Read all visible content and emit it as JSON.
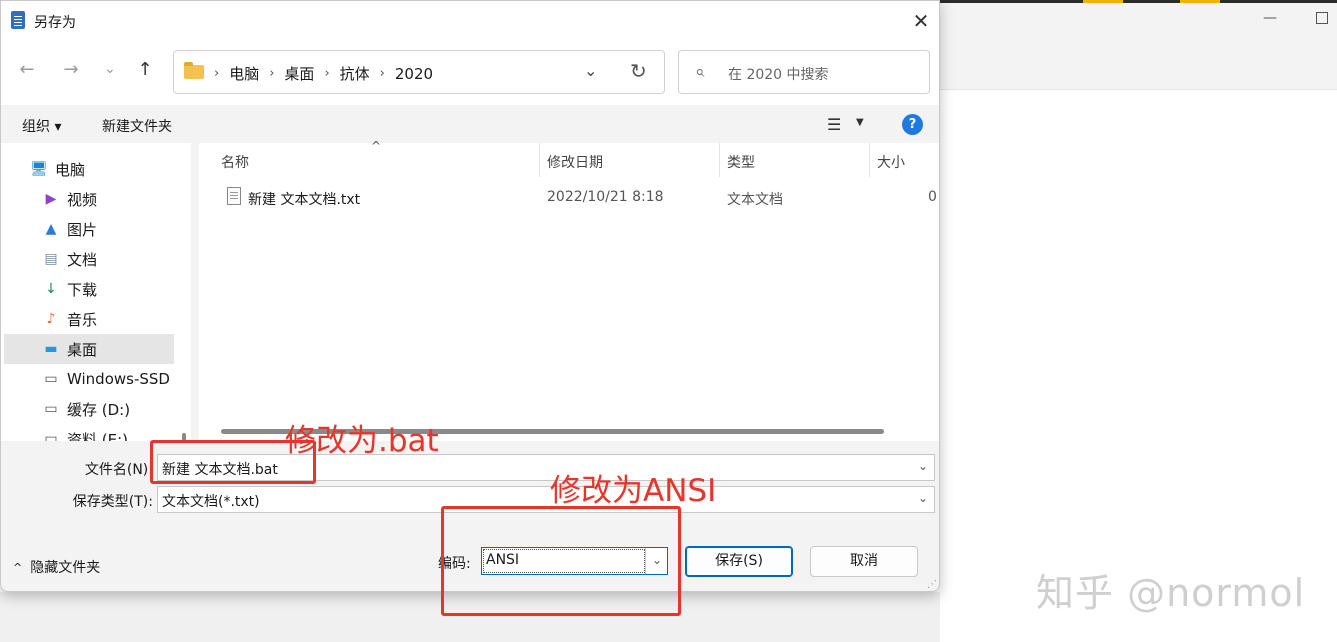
{
  "background_window": {
    "minimize_glyph": "—"
  },
  "dialog": {
    "title": "另存为",
    "close_glyph": "✕"
  },
  "nav": {
    "back_glyph": "←",
    "forward_glyph": "→",
    "recent_glyph": "⌄",
    "up_glyph": "↑",
    "breadcrumbs": [
      "电脑",
      "桌面",
      "抗体",
      "2020"
    ],
    "breadcrumb_sep": "›",
    "dropdown_glyph": "⌄",
    "refresh_glyph": "↻",
    "search_glyph": "⌕",
    "search_placeholder": "在 2020 中搜索"
  },
  "commandbar": {
    "organize_label": "组织 ▾",
    "new_folder_label": "新建文件夹",
    "view_glyph": "☰",
    "view_dropdown_glyph": "▼",
    "help_glyph": "?"
  },
  "tree": {
    "items": [
      {
        "label": "电脑",
        "icon": "computer-icon",
        "glyph": "🖥",
        "color": "#1a86d1"
      },
      {
        "label": "视频",
        "icon": "video-icon",
        "glyph": "▶",
        "color": "#8e44c8"
      },
      {
        "label": "图片",
        "icon": "picture-icon",
        "glyph": "▲",
        "color": "#2b7cd3"
      },
      {
        "label": "文档",
        "icon": "document-icon",
        "glyph": "▤",
        "color": "#7a8ca0"
      },
      {
        "label": "下载",
        "icon": "download-icon",
        "glyph": "↓",
        "color": "#1b8a5a"
      },
      {
        "label": "音乐",
        "icon": "music-icon",
        "glyph": "♪",
        "color": "#e36b3c"
      },
      {
        "label": "桌面",
        "icon": "desktop-icon",
        "glyph": "▬",
        "color": "#1f9bd9"
      },
      {
        "label": "Windows-SSD",
        "icon": "drive-icon",
        "glyph": "▭",
        "color": "#555555"
      },
      {
        "label": "缓存 (D:)",
        "icon": "drive-icon",
        "glyph": "▭",
        "color": "#555555"
      },
      {
        "label": "资料 (E:)",
        "icon": "drive-icon",
        "glyph": "▭",
        "color": "#555555"
      }
    ],
    "selected_index": 6
  },
  "filelist": {
    "columns": [
      "名称",
      "修改日期",
      "类型",
      "大小"
    ],
    "sort_glyph": "^",
    "rows": [
      {
        "name": "新建 文本文档.txt",
        "date": "2022/10/21 8:18",
        "type": "文本文档",
        "size": "0"
      }
    ]
  },
  "form": {
    "filename_label": "文件名(N):",
    "filename_value": "新建 文本文档.bat",
    "filetype_label": "保存类型(T):",
    "filetype_value": "文本文档(*.txt)",
    "dropdown_glyph": "⌄",
    "hide_folders_label": "隐藏文件夹",
    "hide_folders_glyph": "^",
    "encoding_label": "编码:",
    "encoding_value": "ANSI",
    "save_label": "保存(S)",
    "cancel_label": "取消",
    "grip_glyph": "⋰"
  },
  "annotations": {
    "filename_note": "修改为.bat",
    "encoding_note": "修改为ANSI",
    "color": "#e8352b"
  },
  "watermark": "知乎 @normol"
}
